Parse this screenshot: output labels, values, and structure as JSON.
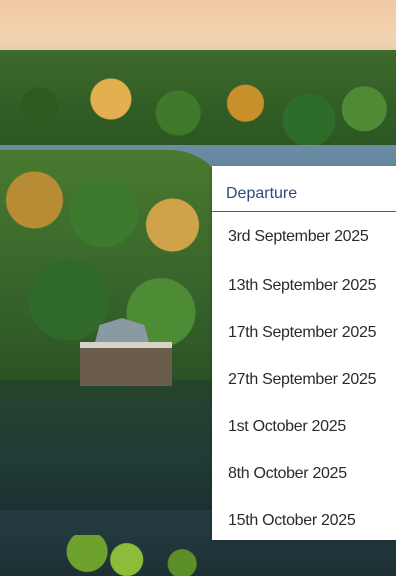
{
  "dropdown": {
    "title": "Departure",
    "options": [
      "3rd September 2025",
      "13th September 2025",
      "17th September 2025",
      "27th September 2025",
      "1st October 2025",
      "8th October 2025",
      "15th October 2025"
    ]
  },
  "colors": {
    "title_text": "#2f4a7a",
    "option_text": "#2b2b2b",
    "divider": "#4a5a78"
  }
}
